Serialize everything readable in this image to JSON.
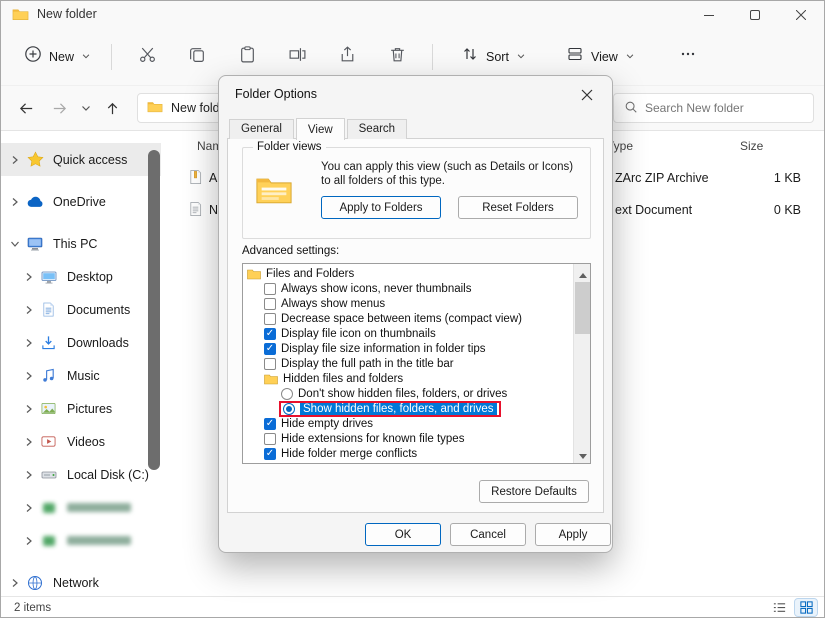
{
  "colors": {
    "accent": "#0067c0",
    "selection": "#0078d7",
    "annotation_red": "#e8112d",
    "checkbox_fill": "#0a6cd6"
  },
  "window": {
    "title": "New folder"
  },
  "toolbar": {
    "new_label": "New",
    "sort_label": "Sort",
    "view_label": "View"
  },
  "navbar": {
    "address_text": "New folder",
    "search_placeholder": "Search New folder"
  },
  "columns": {
    "name": "Name",
    "type": "Type",
    "size": "Size"
  },
  "files": [
    {
      "name": "Ar",
      "type": "ZArc ZIP Archive",
      "size": "1 KB",
      "icon": "archive"
    },
    {
      "name": "N",
      "type": "ext Document",
      "size": "0 KB",
      "icon": "textdoc"
    }
  ],
  "sidebar": {
    "items": [
      {
        "label": "Quick access",
        "icon": "star",
        "chev": "right",
        "level": 0,
        "selected": true
      },
      {
        "label": "OneDrive",
        "icon": "cloud",
        "chev": "right",
        "level": 0,
        "gap": true
      },
      {
        "label": "This PC",
        "icon": "pc",
        "chev": "down",
        "level": 0,
        "gap": true
      },
      {
        "label": "Desktop",
        "icon": "desktop",
        "chev": "right",
        "level": 1
      },
      {
        "label": "Documents",
        "icon": "documents",
        "chev": "right",
        "level": 1
      },
      {
        "label": "Downloads",
        "icon": "downloads",
        "chev": "right",
        "level": 1
      },
      {
        "label": "Music",
        "icon": "music",
        "chev": "right",
        "level": 1
      },
      {
        "label": "Pictures",
        "icon": "pictures",
        "chev": "right",
        "level": 1
      },
      {
        "label": "Videos",
        "icon": "videos",
        "chev": "right",
        "level": 1
      },
      {
        "label": "Local Disk (C:)",
        "icon": "disk",
        "chev": "right",
        "level": 1
      },
      {
        "label": "",
        "icon": "redacted",
        "chev": "right",
        "level": 1,
        "redacted": true
      },
      {
        "label": "",
        "icon": "redacted",
        "chev": "right",
        "level": 1,
        "redacted": true
      },
      {
        "label": "Network",
        "icon": "network",
        "chev": "right",
        "level": 0,
        "gap": true
      }
    ]
  },
  "statusbar": {
    "items_count": "2 items"
  },
  "dialog": {
    "title": "Folder Options",
    "tabs": [
      {
        "label": "General",
        "active": false
      },
      {
        "label": "View",
        "active": true
      },
      {
        "label": "Search",
        "active": false
      }
    ],
    "folder_views": {
      "group_label": "Folder views",
      "description": "You can apply this view (such as Details or Icons) to all folders of this type.",
      "apply_to_folders": "Apply to Folders",
      "reset_folders": "Reset Folders"
    },
    "advanced_settings_label": "Advanced settings:",
    "advanced_items": [
      {
        "kind": "folder",
        "label": "Files and Folders",
        "indent": 0
      },
      {
        "kind": "checkbox",
        "label": "Always show icons, never thumbnails",
        "indent": 1,
        "checked": false
      },
      {
        "kind": "checkbox",
        "label": "Always show menus",
        "indent": 1,
        "checked": false
      },
      {
        "kind": "checkbox",
        "label": "Decrease space between items (compact view)",
        "indent": 1,
        "checked": false
      },
      {
        "kind": "checkbox",
        "label": "Display file icon on thumbnails",
        "indent": 1,
        "checked": true
      },
      {
        "kind": "checkbox",
        "label": "Display file size information in folder tips",
        "indent": 1,
        "checked": true
      },
      {
        "kind": "checkbox",
        "label": "Display the full path in the title bar",
        "indent": 1,
        "checked": false
      },
      {
        "kind": "folder",
        "label": "Hidden files and folders",
        "indent": 1
      },
      {
        "kind": "radio",
        "label": "Don't show hidden files, folders, or drives",
        "indent": 2,
        "checked": false
      },
      {
        "kind": "radio",
        "label": "Show hidden files, folders, and drives",
        "indent": 2,
        "checked": true,
        "selected": true,
        "boxed": true
      },
      {
        "kind": "checkbox",
        "label": "Hide empty drives",
        "indent": 1,
        "checked": true
      },
      {
        "kind": "checkbox",
        "label": "Hide extensions for known file types",
        "indent": 1,
        "checked": false
      },
      {
        "kind": "checkbox",
        "label": "Hide folder merge conflicts",
        "indent": 1,
        "checked": true
      },
      {
        "kind": "checkbox",
        "label": "",
        "indent": 1,
        "checked": true
      }
    ],
    "restore_defaults": "Restore Defaults",
    "ok": "OK",
    "cancel": "Cancel",
    "apply": "Apply"
  }
}
